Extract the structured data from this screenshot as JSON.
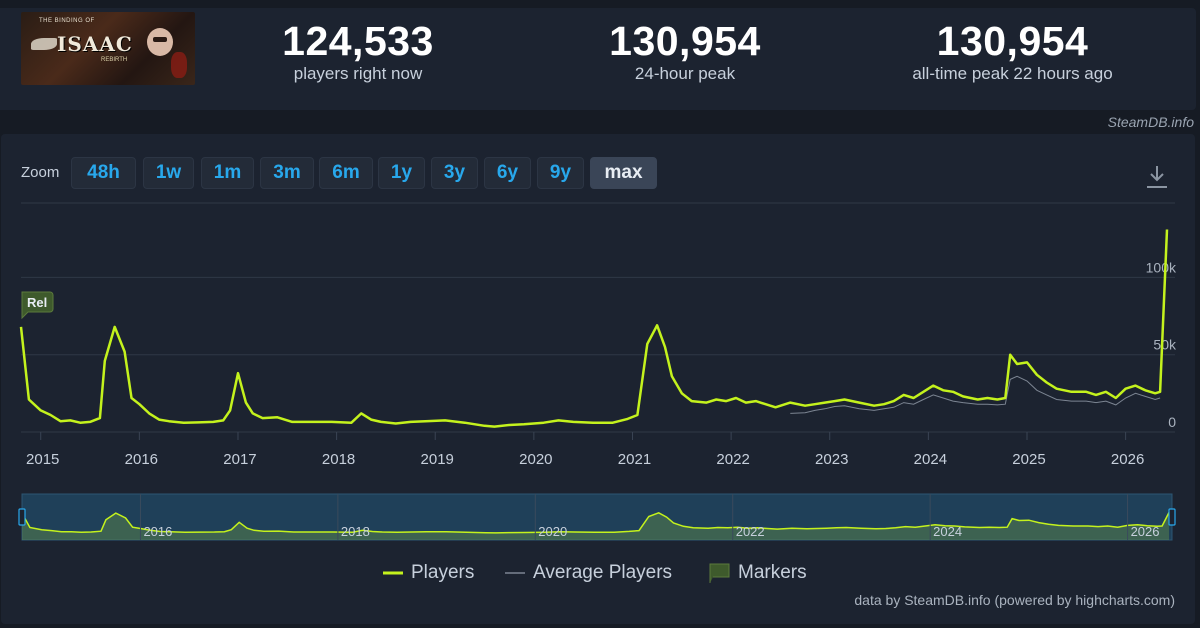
{
  "header": {
    "game_logo_lines": {
      "top": "THE BINDING OF",
      "title": "ISAAC",
      "edition": "REBIRTH"
    },
    "stats": [
      {
        "value": "124,533",
        "label": "players right now"
      },
      {
        "value": "130,954",
        "label": "24-hour peak"
      },
      {
        "value": "130,954",
        "label": "all-time peak 22 hours ago"
      }
    ],
    "brand": "SteamDB.info"
  },
  "zoom": {
    "label": "Zoom",
    "buttons": [
      "48h",
      "1w",
      "1m",
      "3m",
      "6m",
      "1y",
      "3y",
      "6y",
      "9y",
      "max"
    ],
    "active": "max"
  },
  "colors": {
    "players": "#c4f21d",
    "average": "#7c8592",
    "marker_fill": "#3e5a2c",
    "grid": "#2f3846",
    "navigator_bg": "#1f4059"
  },
  "chart_data": {
    "type": "line",
    "x_unit": "year",
    "xlim": [
      2014.8,
      2026.45
    ],
    "ylim": [
      0,
      130000
    ],
    "y_ticks": [
      0,
      50000,
      100000
    ],
    "y_tick_labels": [
      "0",
      "50k",
      "100k"
    ],
    "x_ticks": [
      2015,
      2016,
      2017,
      2018,
      2019,
      2020,
      2021,
      2022,
      2023,
      2024,
      2025,
      2026
    ],
    "x_tick_labels": [
      "2015",
      "2016",
      "2017",
      "2018",
      "2019",
      "2020",
      "2021",
      "2022",
      "2023",
      "2024",
      "2025",
      "2026"
    ],
    "navigator_labels": [
      "2016",
      "2018",
      "2020",
      "2022",
      "2024",
      "2026"
    ],
    "series": [
      {
        "name": "Players",
        "x": [
          2014.8,
          2014.88,
          2015.0,
          2015.1,
          2015.2,
          2015.3,
          2015.4,
          2015.5,
          2015.6,
          2015.65,
          2015.75,
          2015.85,
          2015.92,
          2016.0,
          2016.1,
          2016.2,
          2016.3,
          2016.45,
          2016.6,
          2016.75,
          2016.85,
          2016.92,
          2017.0,
          2017.08,
          2017.15,
          2017.25,
          2017.4,
          2017.55,
          2017.75,
          2017.95,
          2018.15,
          2018.25,
          2018.35,
          2018.45,
          2018.6,
          2018.75,
          2018.9,
          2019.1,
          2019.3,
          2019.5,
          2019.6,
          2019.75,
          2019.9,
          2020.1,
          2020.25,
          2020.4,
          2020.6,
          2020.8,
          2020.95,
          2021.05,
          2021.15,
          2021.25,
          2021.33,
          2021.4,
          2021.5,
          2021.6,
          2021.75,
          2021.85,
          2021.95,
          2022.05,
          2022.15,
          2022.25,
          2022.35,
          2022.45,
          2022.6,
          2022.75,
          2022.85,
          2022.95,
          2023.05,
          2023.15,
          2023.3,
          2023.45,
          2023.55,
          2023.65,
          2023.75,
          2023.85,
          2023.95,
          2024.05,
          2024.15,
          2024.25,
          2024.35,
          2024.5,
          2024.6,
          2024.7,
          2024.78,
          2024.83,
          2024.9,
          2025.0,
          2025.1,
          2025.2,
          2025.3,
          2025.45,
          2025.6,
          2025.7,
          2025.8,
          2025.9,
          2026.0,
          2026.1,
          2026.2,
          2026.3,
          2026.35,
          2026.42
        ],
        "y": [
          68000,
          21000,
          14000,
          11000,
          7000,
          7500,
          6000,
          6500,
          9000,
          46000,
          68000,
          52000,
          22000,
          18000,
          12000,
          8000,
          7000,
          6000,
          6200,
          6500,
          7500,
          14000,
          38000,
          19000,
          12000,
          9000,
          9500,
          6500,
          6500,
          6500,
          6000,
          12000,
          8000,
          6500,
          5500,
          6500,
          7000,
          7500,
          6000,
          4000,
          3500,
          4500,
          5000,
          6000,
          7500,
          6500,
          6000,
          6000,
          8500,
          11000,
          57000,
          69000,
          55000,
          36000,
          25000,
          20000,
          19000,
          21000,
          20000,
          22000,
          19000,
          20000,
          18000,
          16000,
          19000,
          17000,
          18000,
          19000,
          20000,
          21000,
          19000,
          17000,
          18000,
          20000,
          24000,
          22000,
          26000,
          30000,
          27000,
          26000,
          23000,
          21000,
          22000,
          21000,
          22000,
          50000,
          44000,
          45000,
          37000,
          32000,
          28000,
          26000,
          26000,
          24000,
          26000,
          22000,
          28000,
          30000,
          27000,
          25000,
          26000,
          130954
        ]
      },
      {
        "name": "Average Players",
        "x": [
          2022.6,
          2022.75,
          2022.85,
          2022.95,
          2023.05,
          2023.15,
          2023.3,
          2023.45,
          2023.55,
          2023.65,
          2023.75,
          2023.85,
          2023.95,
          2024.05,
          2024.15,
          2024.25,
          2024.35,
          2024.5,
          2024.6,
          2024.7,
          2024.78,
          2024.83,
          2024.9,
          2025.0,
          2025.1,
          2025.2,
          2025.3,
          2025.45,
          2025.6,
          2025.7,
          2025.8,
          2025.9,
          2026.0,
          2026.1,
          2026.2,
          2026.3,
          2026.35
        ],
        "y": [
          12000,
          12500,
          14000,
          15000,
          16500,
          17000,
          15000,
          14000,
          15000,
          16000,
          19000,
          18000,
          21000,
          24000,
          22000,
          20000,
          19000,
          18000,
          18000,
          17500,
          18000,
          34000,
          36000,
          33000,
          27000,
          24000,
          21000,
          20000,
          20000,
          19000,
          20000,
          17500,
          22000,
          25000,
          23000,
          21000,
          22000
        ]
      }
    ],
    "markers": [
      {
        "label": "Rel",
        "x": 2014.8
      }
    ],
    "legend": [
      {
        "name": "Players"
      },
      {
        "name": "Average Players"
      },
      {
        "name": "Markers"
      }
    ],
    "legend_position": "bottom-center",
    "grid": true
  },
  "footer": {
    "credits": "data by SteamDB.info (powered by highcharts.com)"
  }
}
